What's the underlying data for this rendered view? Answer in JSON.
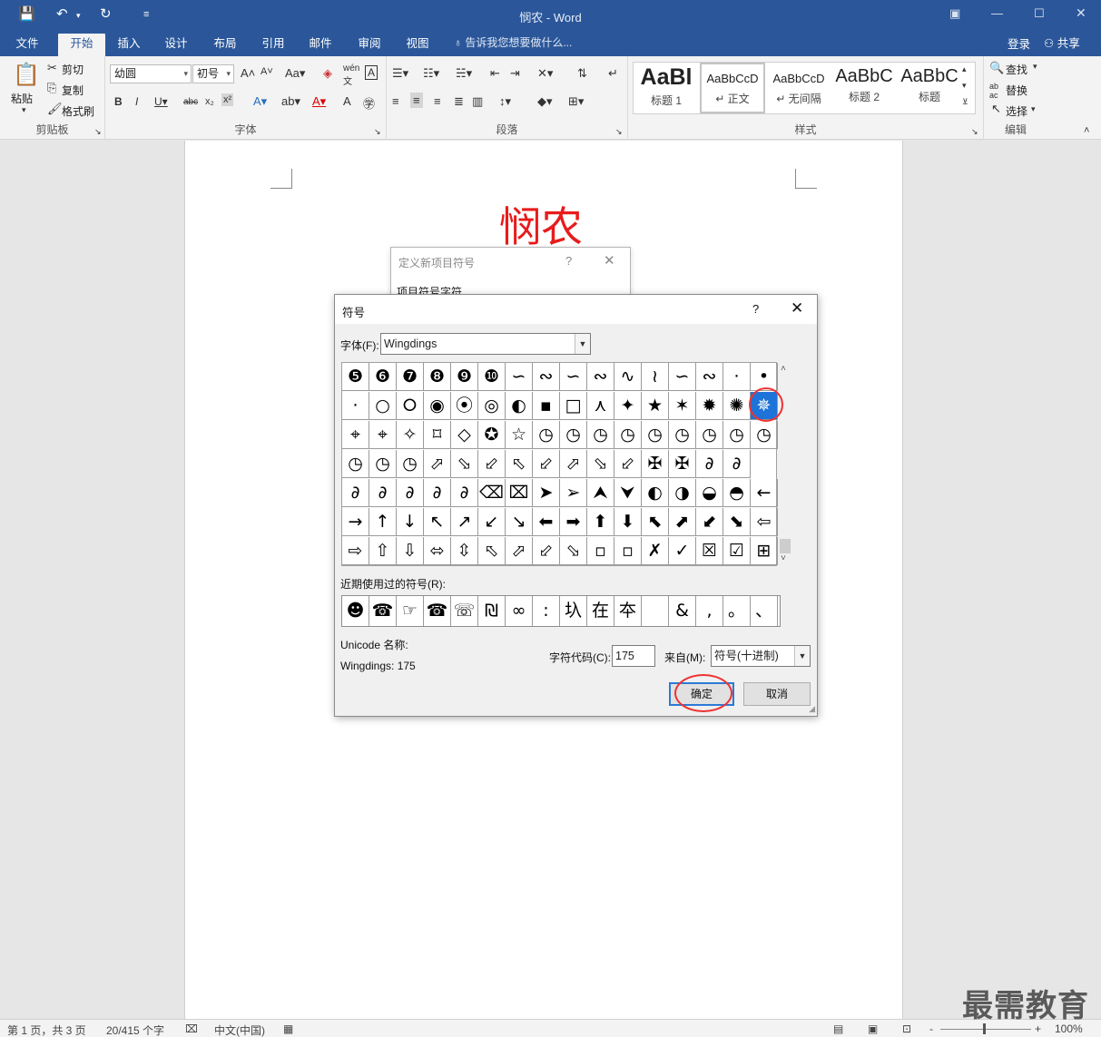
{
  "window": {
    "title": "悯农 - Word",
    "quick_access": [
      "save-icon",
      "undo-icon",
      "redo-icon",
      "customize-icon"
    ]
  },
  "ribbon_tabs": [
    "文件",
    "开始",
    "插入",
    "设计",
    "布局",
    "引用",
    "邮件",
    "审阅",
    "视图"
  ],
  "active_tab": "开始",
  "tell_me": "告诉我您想要做什么...",
  "account": {
    "login": "登录",
    "share": "共享"
  },
  "ribbon": {
    "clipboard": {
      "label": "剪贴板",
      "paste": "粘贴",
      "cut": "剪切",
      "copy": "复制",
      "format_painter": "格式刷"
    },
    "font": {
      "label": "字体",
      "font_name": "幼圆",
      "font_size": "初号"
    },
    "paragraph": {
      "label": "段落"
    },
    "styles": {
      "label": "样式",
      "items": [
        {
          "sample": "AaBl",
          "name": "标题 1"
        },
        {
          "sample": "AaBbCcD",
          "name": "↵ 正文"
        },
        {
          "sample": "AaBbCcD",
          "name": "↵ 无间隔"
        },
        {
          "sample": "AaBbC",
          "name": "标题 2"
        },
        {
          "sample": "AaBbC",
          "name": "标题"
        }
      ]
    },
    "editing": {
      "label": "编辑",
      "find": "查找",
      "replace": "替换",
      "select": "选择"
    }
  },
  "document": {
    "heading": "悯农"
  },
  "back_dialog": {
    "title": "定义新项目符号",
    "section": "项目符号字符"
  },
  "symbol_dialog": {
    "title": "符号",
    "font_label": "字体(F):",
    "font_value": "Wingdings",
    "grid_rows": [
      [
        "❺",
        "❻",
        "❼",
        "❽",
        "❾",
        "❿",
        "∽",
        "∾",
        "∽",
        "∾",
        "∿",
        "≀",
        "∽",
        "∾",
        "·",
        "•"
      ],
      [
        "·",
        "○",
        "⭘",
        "◉",
        "⦿",
        "◎",
        "◐",
        "▪",
        "□",
        "⋏",
        "✦",
        "★",
        "✶",
        "✹",
        "✺",
        "✵"
      ],
      [
        "⌖",
        "⌖",
        "✧",
        "⌑",
        "◇",
        "✪",
        "☆",
        "◷",
        "◷",
        "◷",
        "◷",
        "◷",
        "◷",
        "◷",
        "◷",
        "◷"
      ],
      [
        "◷",
        "◷",
        "◷",
        "⬀",
        "⬂",
        "⬃",
        "⬁",
        "⬃",
        "⬀",
        "⬂",
        "⬃",
        "✠",
        "✠",
        "∂",
        "∂"
      ],
      [
        "∂",
        "∂",
        "∂",
        "∂",
        "∂",
        "⌫",
        "⌧",
        "➤",
        "➢",
        "⮝",
        "⮟",
        "◐",
        "◑",
        "◒",
        "◓",
        "←"
      ],
      [
        "→",
        "↑",
        "↓",
        "↖",
        "↗",
        "↙",
        "↘",
        "⬅",
        "➡",
        "⬆",
        "⬇",
        "⬉",
        "⬈",
        "⬋",
        "⬊",
        "⇦"
      ],
      [
        "⇨",
        "⇧",
        "⇩",
        "⬄",
        "⇳",
        "⬁",
        "⬀",
        "⬃",
        "⬂",
        "▫",
        "▫",
        "✗",
        "✓",
        "☒",
        "☑",
        "⊞"
      ]
    ],
    "selected_cell": [
      1,
      15
    ],
    "recent_label": "近期使用过的符号(R):",
    "recent_symbols": [
      "☻",
      "☎",
      "☞",
      "☎",
      "☏",
      "₪",
      "∞",
      ":",
      "圦",
      "在",
      "夲",
      "",
      "&",
      ",",
      "。",
      "、"
    ],
    "unicode_label": "Unicode 名称:",
    "unicode_name": "Wingdings: 175",
    "char_code_label": "字符代码(C):",
    "char_code_value": "175",
    "from_label": "来自(M):",
    "from_value": "符号(十进制)",
    "ok": "确定",
    "cancel": "取消"
  },
  "statusbar": {
    "page": "第 1 页，共 3 页",
    "words": "20/415 个字",
    "language": "中文(中国)",
    "zoom": "100%",
    "zoom_minus": "-",
    "zoom_plus": "+"
  },
  "watermark": "最需教育",
  "colors": {
    "word_blue": "#2b579a",
    "heading_red": "#e81b1b",
    "selection_blue": "#1e73d8",
    "annotation_red": "#ee3333"
  }
}
